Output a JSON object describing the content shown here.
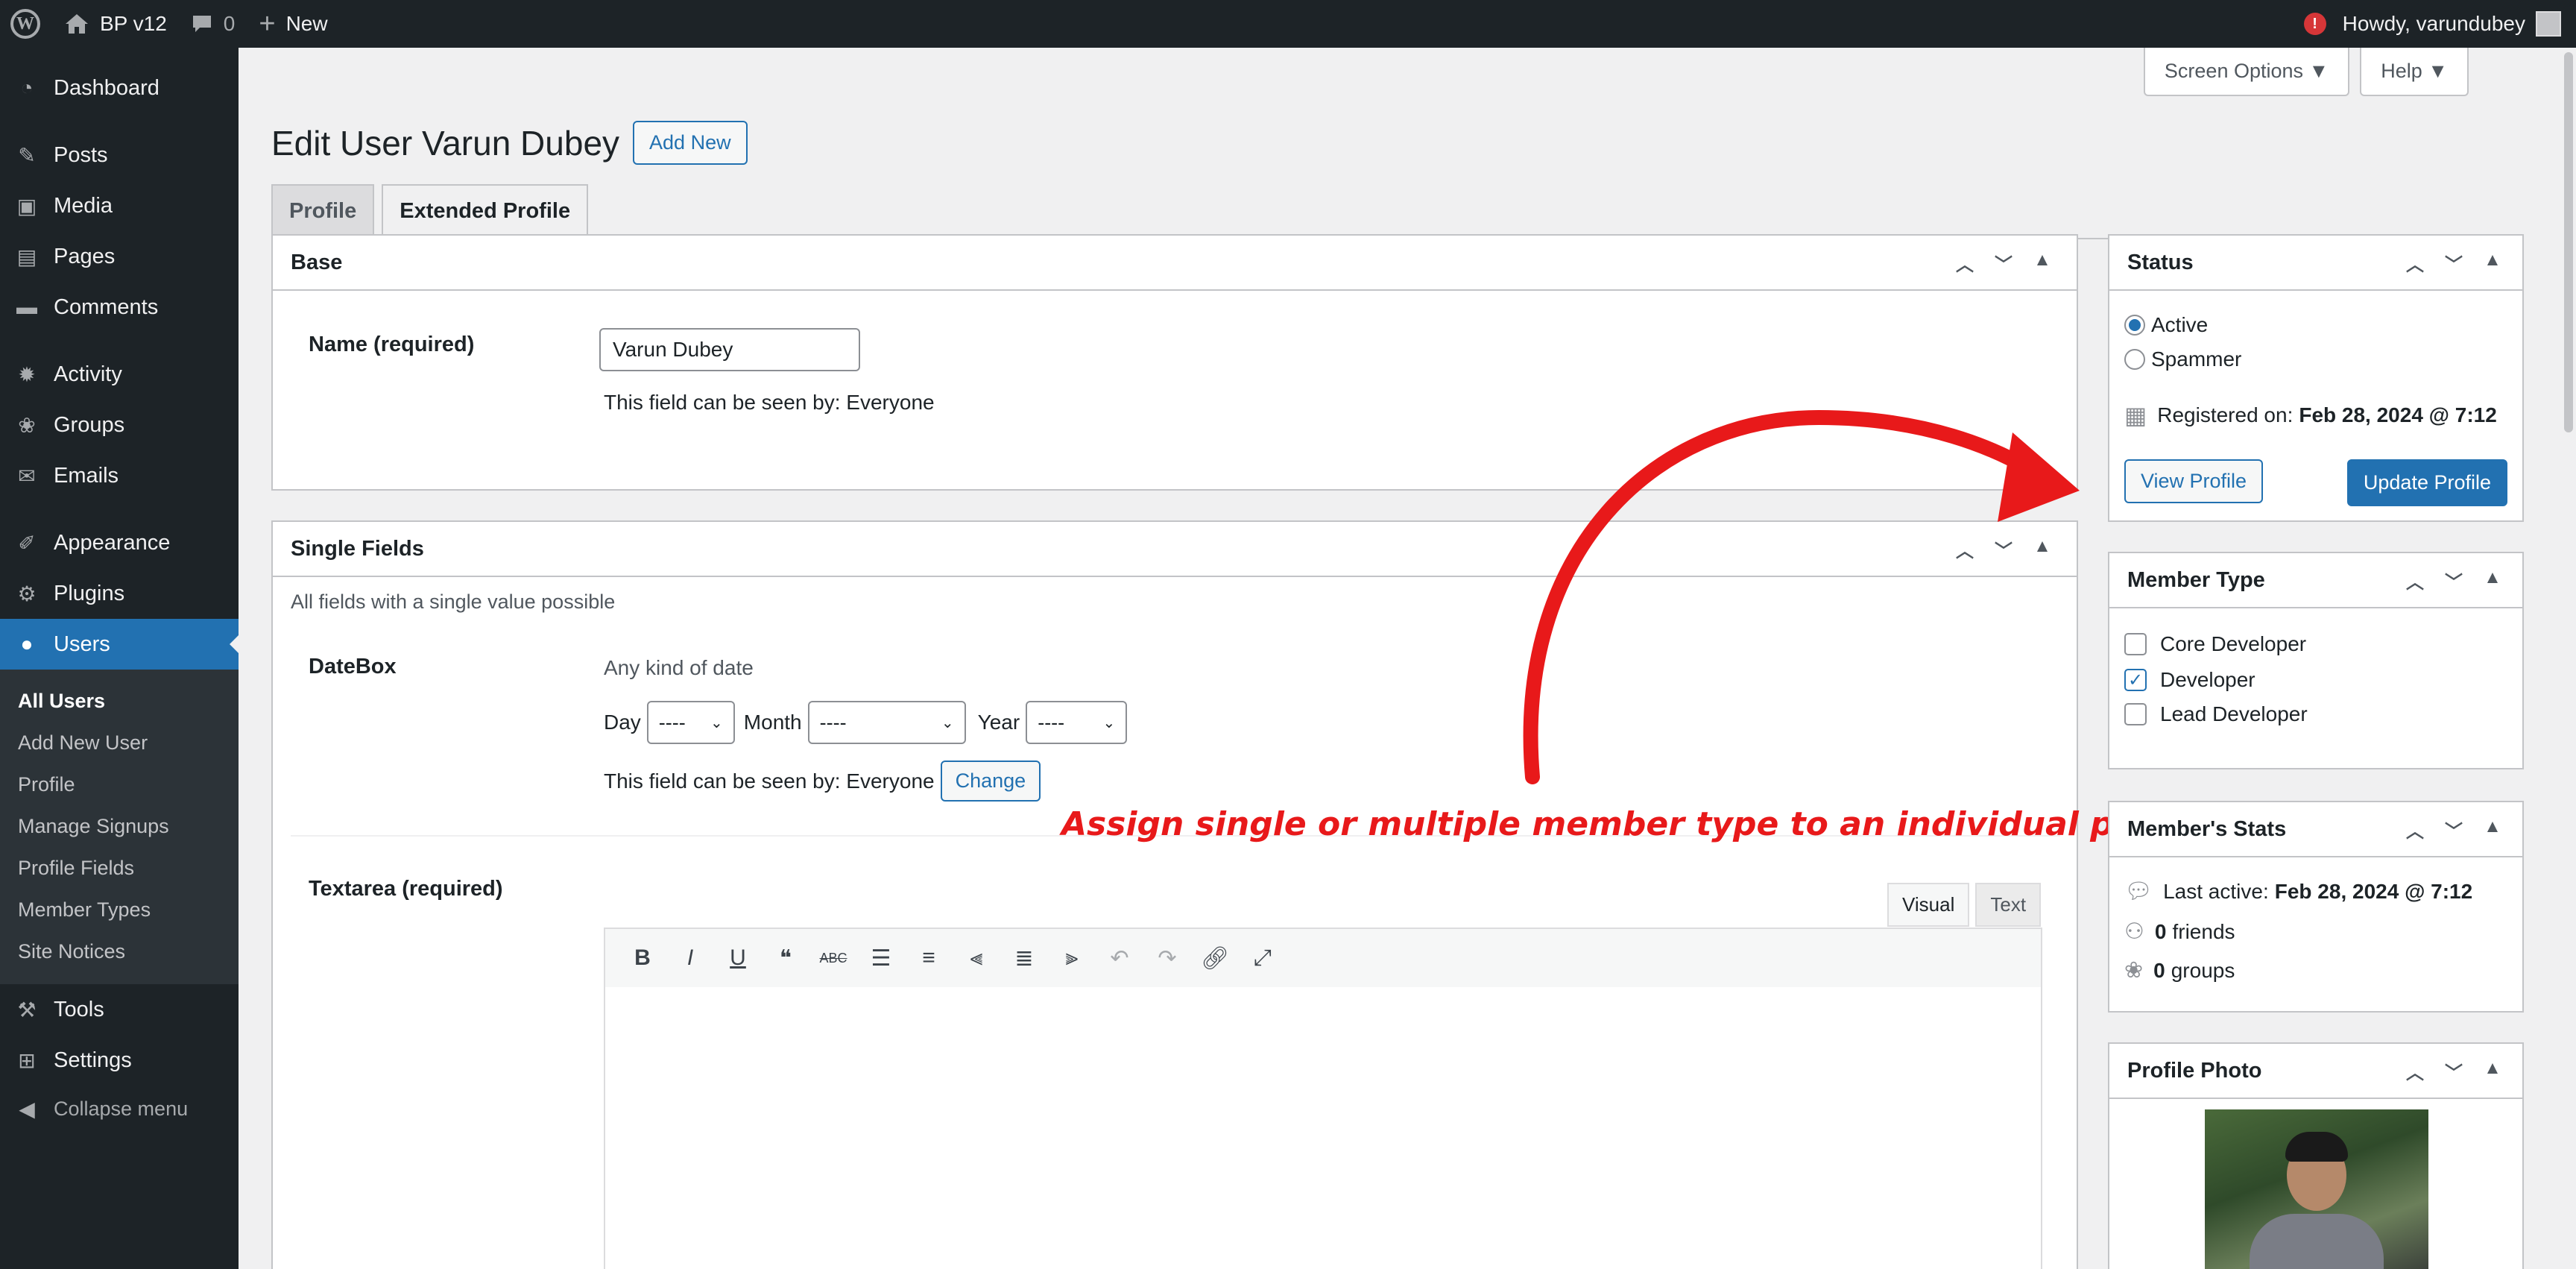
{
  "adminbar": {
    "site_name": "BP v12",
    "comments_count": "0",
    "new_label": "New",
    "howdy": "Howdy, varundubey",
    "alert": "!"
  },
  "sidebar": {
    "items": [
      {
        "label": "Dashboard",
        "icon": "dashboard-icon"
      },
      {
        "label": "Posts",
        "icon": "pin-icon"
      },
      {
        "label": "Media",
        "icon": "media-icon"
      },
      {
        "label": "Pages",
        "icon": "pages-icon"
      },
      {
        "label": "Comments",
        "icon": "comment-icon"
      },
      {
        "label": "Activity",
        "icon": "activity-icon"
      },
      {
        "label": "Groups",
        "icon": "groups-icon"
      },
      {
        "label": "Emails",
        "icon": "email-icon"
      },
      {
        "label": "Appearance",
        "icon": "brush-icon"
      },
      {
        "label": "Plugins",
        "icon": "plugin-icon"
      },
      {
        "label": "Users",
        "icon": "user-icon"
      },
      {
        "label": "Tools",
        "icon": "wrench-icon"
      },
      {
        "label": "Settings",
        "icon": "settings-icon"
      },
      {
        "label": "Collapse menu",
        "icon": "collapse-icon"
      }
    ],
    "submenu": [
      "All Users",
      "Add New User",
      "Profile",
      "Manage Signups",
      "Profile Fields",
      "Member Types",
      "Site Notices"
    ]
  },
  "header": {
    "title": "Edit User Varun Dubey",
    "add_new": "Add New",
    "screen_options": "Screen Options ▼",
    "help": "Help ▼",
    "tabs": [
      "Profile",
      "Extended Profile"
    ]
  },
  "base": {
    "title": "Base",
    "name_label": "Name (required)",
    "name_value": "Varun Dubey",
    "visibility": "This field can be seen by: Everyone"
  },
  "single_fields": {
    "title": "Single Fields",
    "description": "All fields with a single value possible",
    "datebox_label": "DateBox",
    "datebox_desc": "Any kind of date",
    "day_label": "Day",
    "day_value": "----",
    "month_label": "Month",
    "month_value": "----",
    "year_label": "Year",
    "year_value": "----",
    "visibility": "This field can be seen by: Everyone",
    "change": "Change",
    "textarea_label": "Textarea (required)",
    "tab_visual": "Visual",
    "tab_text": "Text"
  },
  "annotation": "Assign single or multiple member type to an individual profile.",
  "status": {
    "title": "Status",
    "active": "Active",
    "spammer": "Spammer",
    "registered_prefix": "Registered on:",
    "registered_date": "Feb 28, 2024 @ 7:12",
    "view_profile": "View Profile",
    "update_profile": "Update Profile"
  },
  "member_type": {
    "title": "Member Type",
    "options": [
      "Core Developer",
      "Developer",
      "Lead Developer"
    ],
    "checked": [
      false,
      true,
      false
    ]
  },
  "stats": {
    "title": "Member's Stats",
    "last_active_prefix": "Last active:",
    "last_active": "Feb 28, 2024 @ 7:12",
    "friends_count": "0",
    "friends_label": "friends",
    "groups_count": "0",
    "groups_label": "groups"
  },
  "photo": {
    "title": "Profile Photo"
  },
  "colors": {
    "accent": "#2271b1",
    "annotation": "#e8191a",
    "sidebar": "#1d2327"
  }
}
